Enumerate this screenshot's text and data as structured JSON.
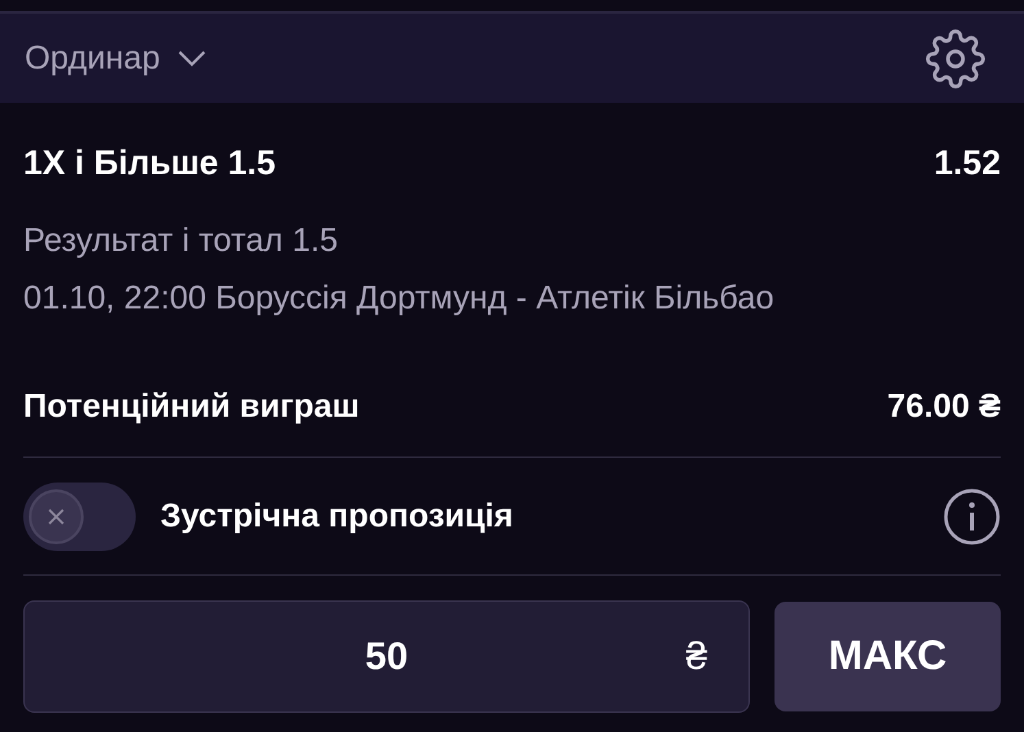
{
  "bet_type": {
    "label": "Ординар"
  },
  "selection": {
    "name": "1X і Більше 1.5",
    "odds": "1.52"
  },
  "market": "Результат і тотал 1.5",
  "event": "01.10, 22:00 Боруссія Дортмунд - Атлетік Більбао",
  "potential_win": {
    "label": "Потенційний виграш",
    "value": "76.00 ₴"
  },
  "counter_offer": {
    "label": "Зустрічна пропозиція",
    "on": false
  },
  "stake": {
    "value": "50",
    "currency": "₴"
  },
  "max_button": "МАКС"
}
